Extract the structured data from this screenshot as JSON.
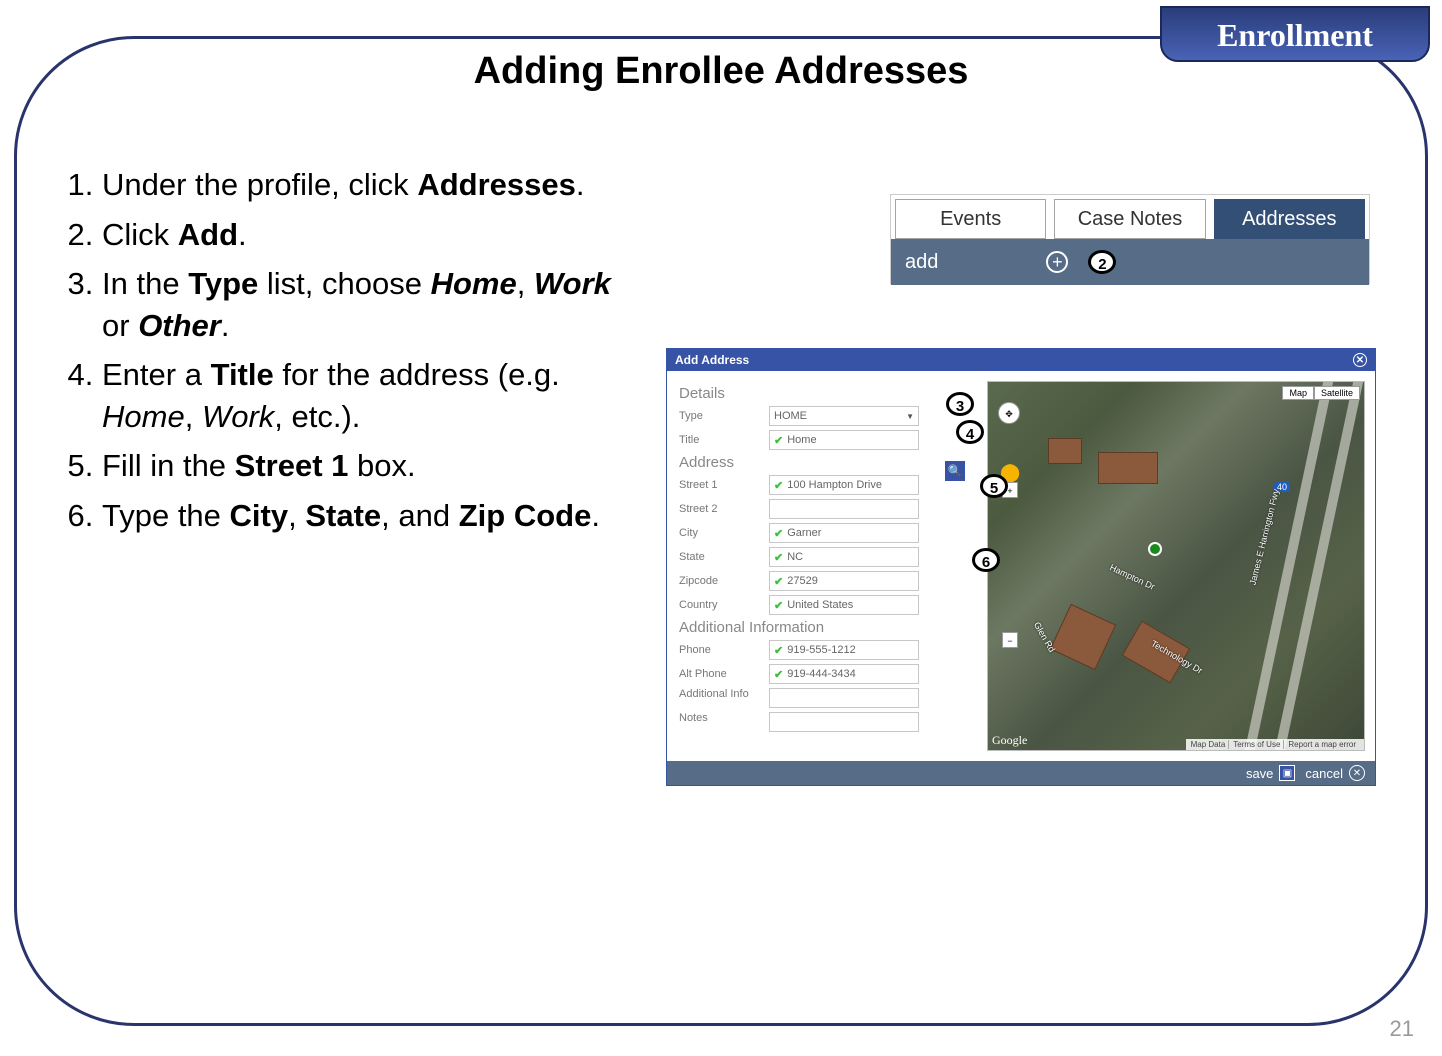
{
  "header": {
    "badge": "Enrollment"
  },
  "title": "Adding Enrollee Addresses",
  "pageNumber": "21",
  "steps": [
    {
      "n": "1.",
      "pre": "Under the profile, click ",
      "b": "Addresses",
      "post": "."
    },
    {
      "n": "2.",
      "pre": "Click ",
      "b": "Add",
      "post": "."
    },
    {
      "n": "3.",
      "pre": "In the ",
      "b": "Type",
      "mid": " list, choose ",
      "bi1": "Home",
      "sep1": ", ",
      "bi2": "Work",
      "sep2": " or ",
      "bi3": "Other",
      "post": "."
    },
    {
      "n": "4.",
      "pre": "Enter a ",
      "b": "Title",
      "mid": " for the address (e.g. ",
      "i1": "Home",
      "sep1": ", ",
      "i2": "Work",
      "post": ", etc.)."
    },
    {
      "n": "5.",
      "pre": "Fill in the ",
      "b": "Street 1",
      "post": " box."
    },
    {
      "n": "6.",
      "pre": "Type the ",
      "b": "City",
      "sep1": ", ",
      "b2": "State",
      "sep2": ", and ",
      "b3": "Zip Code",
      "post": "."
    }
  ],
  "tabstrip": {
    "tabs": [
      "Events",
      "Case Notes",
      "Addresses"
    ],
    "activeIndex": 2,
    "addLabel": "add"
  },
  "callouts": {
    "two": "2",
    "three": "3",
    "four": "4",
    "five": "5",
    "six": "6"
  },
  "dialog": {
    "title": "Add Address",
    "sections": {
      "details": "Details",
      "address": "Address",
      "additional": "Additional Information"
    },
    "labels": {
      "type": "Type",
      "title": "Title",
      "street1": "Street 1",
      "street2": "Street 2",
      "city": "City",
      "state": "State",
      "zip": "Zipcode",
      "country": "Country",
      "phone": "Phone",
      "altPhone": "Alt Phone",
      "addlInfo": "Additional Info",
      "notes": "Notes"
    },
    "values": {
      "type": "HOME",
      "title": "Home",
      "street1": "100 Hampton Drive",
      "street2": "",
      "city": "Garner",
      "state": "NC",
      "zip": "27529",
      "country": "United States",
      "phone": "919-555-1212",
      "altPhone": "919-444-3434",
      "addlInfo": "",
      "notes": ""
    },
    "footer": {
      "save": "save",
      "cancel": "cancel"
    },
    "map": {
      "typeButtons": [
        "Map",
        "Satellite"
      ],
      "route": "40",
      "streets": [
        "Hampton Dr",
        "Glen Rd",
        "James E Harrington Fwy",
        "Technology Dr"
      ],
      "brand": "Google",
      "footer": [
        "Map Data",
        "Terms of Use",
        "Report a map error"
      ]
    }
  }
}
